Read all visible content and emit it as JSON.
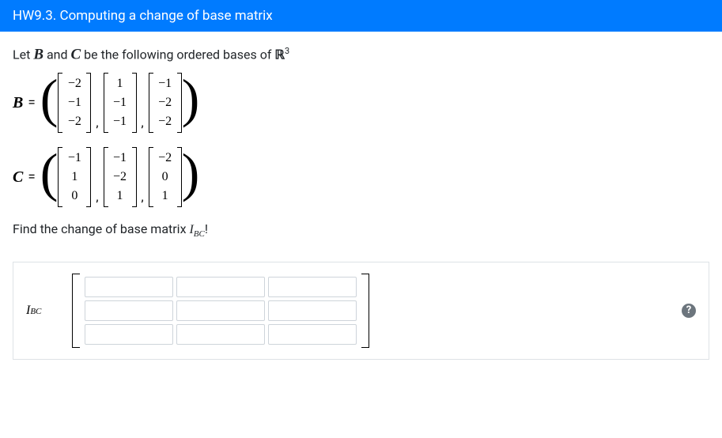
{
  "header": {
    "title": "HW9.3. Computing a change of base matrix"
  },
  "intro": {
    "prefix": "Let ",
    "basis1": "B",
    "and": " and ",
    "basis2": "C",
    "suffix": " be the following ordered bases of ",
    "space": "ℝ",
    "dim": "3"
  },
  "basisB": {
    "label": "B",
    "eq": "=",
    "vectors": [
      [
        "−2",
        "−1",
        "−2"
      ],
      [
        "1",
        "−1",
        "−1"
      ],
      [
        "−1",
        "−2",
        "−2"
      ]
    ]
  },
  "basisC": {
    "label": "C",
    "eq": "=",
    "vectors": [
      [
        "−1",
        "1",
        "0"
      ],
      [
        "−1",
        "−2",
        "1"
      ],
      [
        "−2",
        "0",
        "1"
      ]
    ]
  },
  "prompt": {
    "prefix": "Find the change of base matrix ",
    "symbol": "I",
    "sub": "BC",
    "suffix": "!"
  },
  "answer": {
    "symbol": "I",
    "sub": "BC",
    "values": [
      "",
      "",
      "",
      "",
      "",
      "",
      "",
      "",
      ""
    ]
  },
  "help": {
    "tooltip": "?"
  }
}
